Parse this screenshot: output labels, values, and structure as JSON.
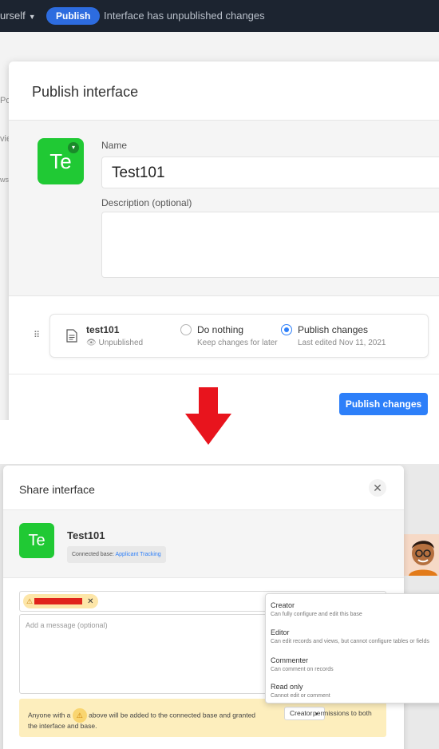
{
  "top": {
    "topbar": {
      "left_text": "urself",
      "publish_pill": "Publish",
      "status": "Interface has unpublished changes"
    },
    "bg_fragments": [
      "Po",
      "vie",
      "ws"
    ],
    "publish_modal": {
      "title": "Publish interface",
      "icon_text": "Te",
      "name_label": "Name",
      "name_value": "Test101",
      "description_label": "Description (optional)",
      "description_value": "",
      "row": {
        "name": "test101",
        "status": "Unpublished",
        "options": [
          {
            "title": "Do nothing",
            "subtitle": "Keep changes for later",
            "selected": false
          },
          {
            "title": "Publish changes",
            "subtitle": "Last edited Nov 11, 2021",
            "selected": true
          }
        ]
      },
      "submit_label": "Publish changes"
    }
  },
  "arrow_color": "#e8141d",
  "share_modal": {
    "title": "Share interface",
    "icon_text": "Te",
    "name": "Test101",
    "connected_prefix": "Connected base:",
    "connected_link": "Applicant Tracking",
    "message_placeholder": "Add a message (optional)",
    "notice": {
      "part1": "Anyone with a",
      "part2": "above will be added to the connected base and granted",
      "role": "Creator",
      "part3": "permissions to both",
      "part4": "the interface and base."
    },
    "roles": [
      {
        "title": "Creator",
        "desc": "Can fully configure and edit this base"
      },
      {
        "title": "Editor",
        "desc": "Can edit records and views, but cannot configure tables or fields"
      },
      {
        "title": "Commenter",
        "desc": "Can comment on records"
      },
      {
        "title": "Read only",
        "desc": "Cannot edit or comment"
      }
    ]
  },
  "colors": {
    "accent": "#2d7ff9",
    "icon_green": "#20c934",
    "topbar": "#1c2430",
    "notice_bg": "#fdeebd"
  }
}
